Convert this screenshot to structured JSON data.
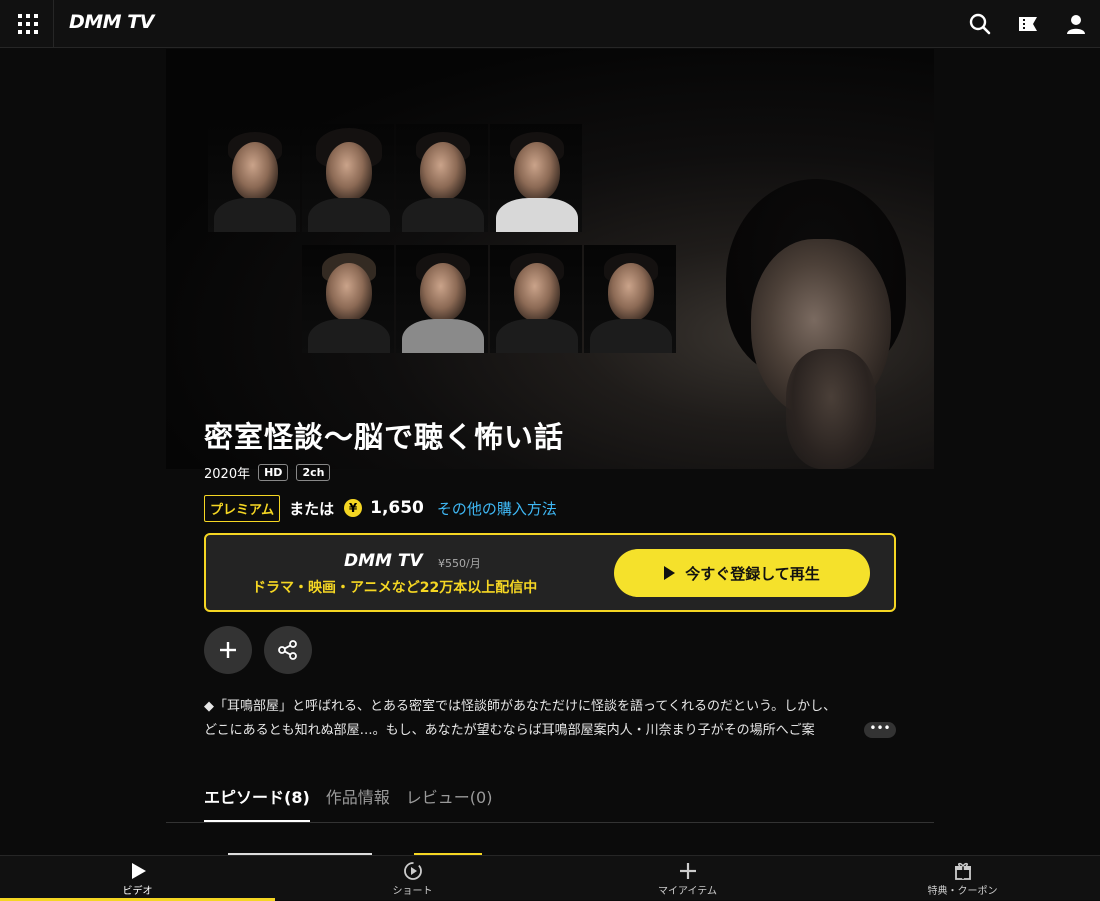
{
  "header": {
    "logo": "DMM TV",
    "icons": [
      "grid-menu-icon",
      "search-icon",
      "ticket-icon",
      "user-icon"
    ]
  },
  "content": {
    "title": "密室怪談〜脳で聴く怖い話",
    "year": "2020年",
    "badges": [
      "HD",
      "2ch"
    ],
    "premium_label": "プレミアム",
    "or_label": "または",
    "yen_symbol": "¥",
    "price": "1,650",
    "other_purchase": "その他の購入方法"
  },
  "promo": {
    "logo": "DMM TV",
    "price": "¥550/月",
    "text": "ドラマ・映画・アニメなど22万本以上配信中",
    "cta_label": "今すぐ登録して再生"
  },
  "actions": [
    "add-icon",
    "share-icon"
  ],
  "description": {
    "line1": "◆「耳鳴部屋」と呼ばれる、とある密室では怪談師があなただけに怪談を語ってくれるのだという。しかし、",
    "line2": "どこにあるとも知れぬ部屋…。もし、あなたが望むならば耳鳴部屋案内人・川奈まり子がその場所へご案",
    "more_label": "•••"
  },
  "tabs": [
    {
      "label": "エピソード(8)",
      "active": true
    },
    {
      "label": "作品情報",
      "active": false
    },
    {
      "label": "レビュー(0)",
      "active": false
    }
  ],
  "bottom_nav": [
    {
      "label": "ビデオ",
      "icon": "play-icon",
      "active": true
    },
    {
      "label": "ショート",
      "icon": "short-play-icon",
      "active": false
    },
    {
      "label": "マイアイテム",
      "icon": "plus-icon",
      "active": false
    },
    {
      "label": "特典・クーポン",
      "icon": "gift-icon",
      "active": false
    }
  ],
  "colors": {
    "accent": "#f5d623",
    "link": "#3fb8f5",
    "background": "#0b0b0b"
  }
}
